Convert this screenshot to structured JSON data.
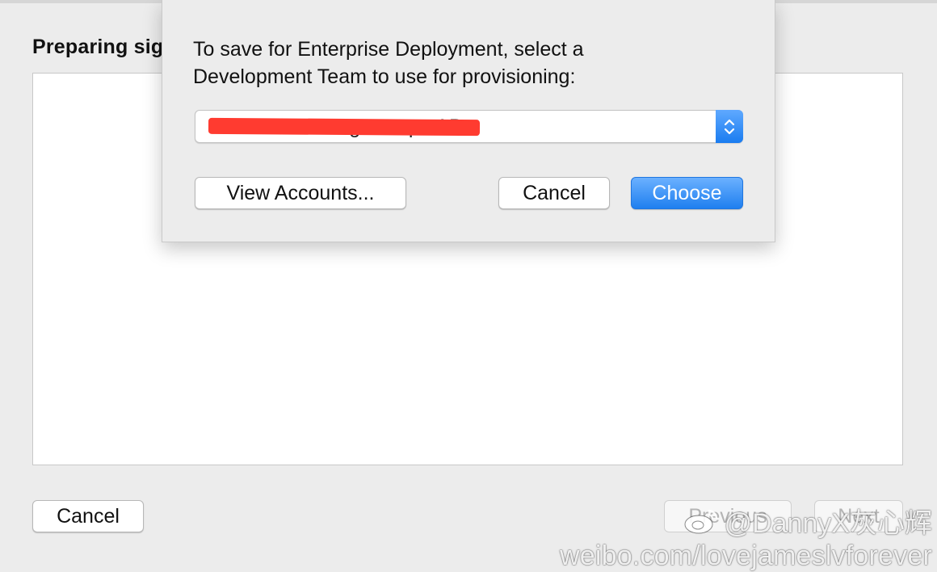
{
  "page": {
    "heading": "Preparing sig",
    "cancel_label": "Cancel",
    "previous_label": "Previous",
    "next_label": "Next"
  },
  "sheet": {
    "message": "To save for Enterprise Deployment, select a Development Team to use for provisioning:",
    "team_select": {
      "value": "Ultimate Gaming Europe AB",
      "redacted": true
    },
    "view_accounts_label": "View Accounts...",
    "cancel_label": "Cancel",
    "choose_label": "Choose"
  },
  "watermark": {
    "handle": "@DannyX灰心辉",
    "url": "weibo.com/lovejameslvforever"
  },
  "colors": {
    "accent": "#2a84f2",
    "redaction": "#ff3b30",
    "window_bg": "#ececec"
  }
}
